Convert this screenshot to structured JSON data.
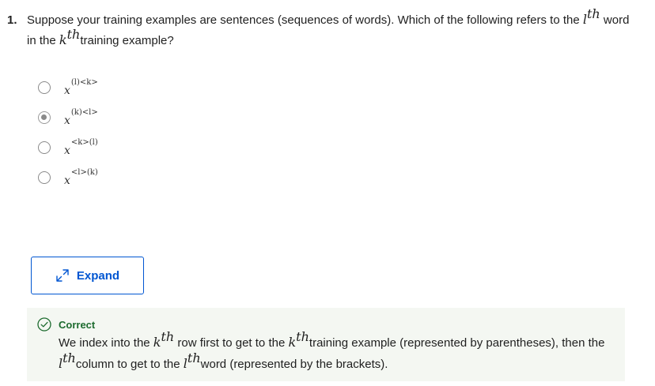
{
  "question": {
    "number": "1.",
    "text_part1": "Suppose your training examples are sentences (sequences of words). Which of the following refers to the ",
    "var_l": "l",
    "sup_th": "th",
    "text_part2": " word in the ",
    "var_k": "k",
    "text_part3": "training example?"
  },
  "options": [
    {
      "base": "x",
      "sup": "(l)<k>",
      "selected": false
    },
    {
      "base": "x",
      "sup": "(k)<l>",
      "selected": true
    },
    {
      "base": "x",
      "sup": "<k>(l)",
      "selected": false
    },
    {
      "base": "x",
      "sup": "<l>(k)",
      "selected": false
    }
  ],
  "expand": {
    "label": "Expand",
    "icon": "expand-arrows-icon"
  },
  "feedback": {
    "status": "Correct",
    "icon": "check-circle-icon",
    "text_part1": "We index into the ",
    "var_k": "k",
    "sup_th": "th",
    "text_part2": " row first to get to the ",
    "text_part3": "training example (represented by parentheses), then the ",
    "var_l": "l",
    "text_part4": "column to get to the ",
    "text_part5": "word (represented by the brackets)."
  },
  "colors": {
    "accent": "#0056d2",
    "correct": "#1d6b2f",
    "feedback_bg": "#f4f7f2"
  }
}
